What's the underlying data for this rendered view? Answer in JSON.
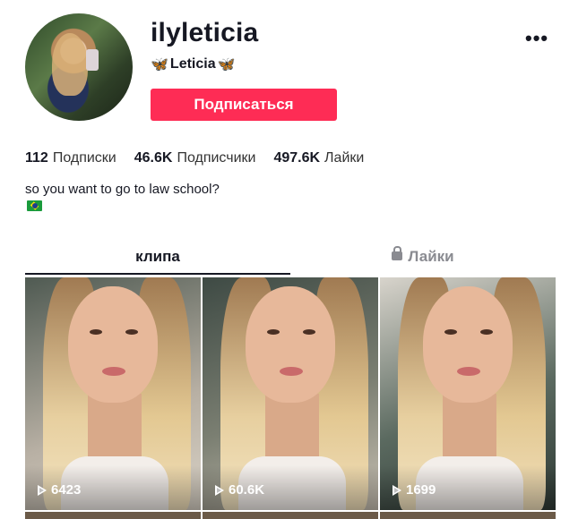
{
  "profile": {
    "username": "ilyleticia",
    "nickname": "Leticia",
    "nickname_emoji": "🦋",
    "follow_label": "Подписаться",
    "more_label": "•••"
  },
  "stats": [
    {
      "value": "112",
      "label": "Подписки"
    },
    {
      "value": "46.6K",
      "label": "Подписчики"
    },
    {
      "value": "497.6K",
      "label": "Лайки"
    }
  ],
  "bio": {
    "text": "so you want to go to law school?",
    "emoji": "brazil-flag"
  },
  "tabs": {
    "videos": "клипа",
    "liked": "Лайки"
  },
  "videos": [
    {
      "views": "6423"
    },
    {
      "views": "60.6K"
    },
    {
      "views": "1699"
    }
  ],
  "colors": {
    "accent": "#fe2c55",
    "text": "#161823",
    "muted": "#8a8b91"
  }
}
